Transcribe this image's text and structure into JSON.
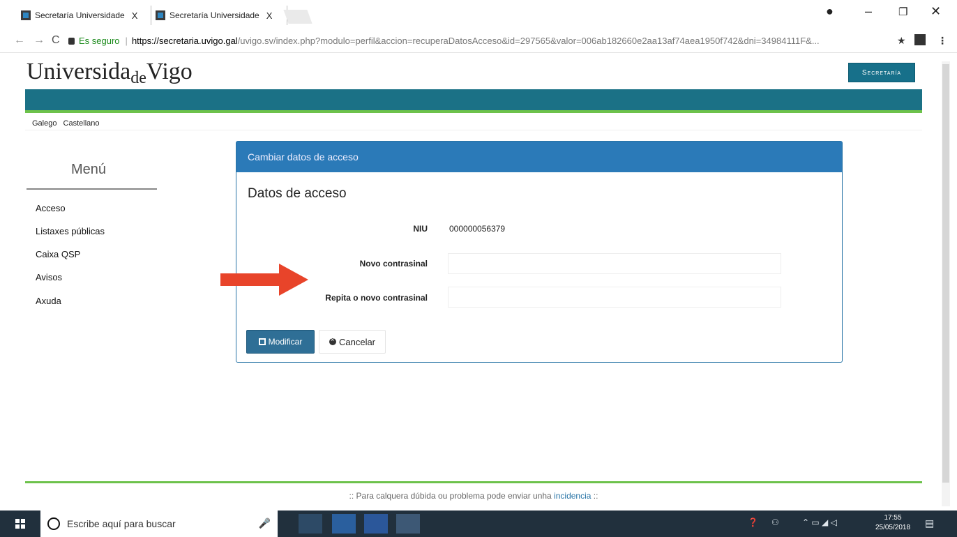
{
  "browser": {
    "tabs": [
      {
        "label": "Secretaría Universidade",
        "close": "X"
      },
      {
        "label": "Secretaría Universidade",
        "close": "X"
      }
    ],
    "window_controls": {
      "minimize": "–",
      "restore": "❐",
      "close": "✕"
    },
    "secure_label": "Es seguro",
    "url_host": "https://secretaria.uvigo.gal",
    "url_rest": "/uvigo.sv/index.php?modulo=perfil&accion=recuperaDatosAcceso&id=297565&valor=006ab182660e2aa13af74aea1950f742&dni=34984111F&..."
  },
  "header": {
    "logo_main": "Universida",
    "logo_sub": "de",
    "logo_end": "Vigo",
    "secretaria_button": "Secretaría"
  },
  "languages": [
    "Galego",
    "Castellano"
  ],
  "menu": {
    "title": "Menú",
    "items": [
      "Acceso",
      "Listaxes públicas",
      "Caixa QSP",
      "Avisos",
      "Axuda"
    ]
  },
  "panel": {
    "header": "Cambiar datos de acceso",
    "subtitle": "Datos de acceso",
    "niu_label": "NIU",
    "niu_value": "000000056379",
    "new_password_label": "Novo contrasinal",
    "repeat_password_label": "Repita o novo contrasinal",
    "new_password_value": "",
    "repeat_password_value": "",
    "modify_button": "Modificar",
    "cancel_button": "Cancelar"
  },
  "footer": {
    "text": ":: Para calquera dúbida ou problema pode enviar unha",
    "link": "incidencia",
    "tail": "::"
  },
  "taskbar": {
    "search_placeholder": "Escribe aquí para buscar",
    "time": "17:55",
    "date": "25/05/2018"
  },
  "colors": {
    "banner": "#1b7186",
    "accent_green": "#6dc24b",
    "panel_header": "#2b7ab8",
    "arrow": "#e8442a"
  }
}
